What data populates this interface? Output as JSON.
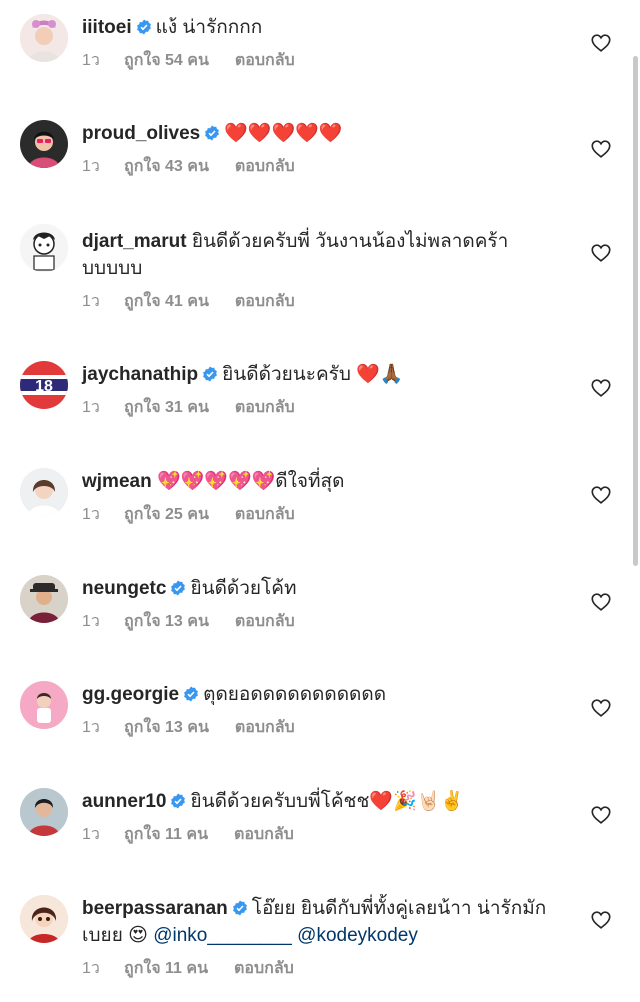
{
  "comments": [
    {
      "username": "iiitoei",
      "verified": true,
      "text": "แง้ น่ารักกกก",
      "time": "1ว",
      "likes": "ถูกใจ 54 คน",
      "reply": "ตอบกลับ"
    },
    {
      "username": "proud_olives",
      "verified": true,
      "text": "❤️❤️❤️❤️❤️",
      "time": "1ว",
      "likes": "ถูกใจ 43 คน",
      "reply": "ตอบกลับ"
    },
    {
      "username": "djart_marut",
      "verified": false,
      "text": "ยินดีด้วยครับพี่ วันงานน้องไม่พลาดคร้าบบบบบ",
      "time": "1ว",
      "likes": "ถูกใจ 41 คน",
      "reply": "ตอบกลับ"
    },
    {
      "username": "jaychanathip",
      "verified": true,
      "text": "ยินดีด้วยนะครับ ❤️🙏🏾",
      "time": "1ว",
      "likes": "ถูกใจ 31 คน",
      "reply": "ตอบกลับ"
    },
    {
      "username": "wjmean",
      "verified": false,
      "text": "💖💖💖💖💖ดีใจที่สุด",
      "time": "1ว",
      "likes": "ถูกใจ 25 คน",
      "reply": "ตอบกลับ"
    },
    {
      "username": "neungetc",
      "verified": true,
      "text": "ยินดีด้วยโค้ท",
      "time": "1ว",
      "likes": "ถูกใจ 13 คน",
      "reply": "ตอบกลับ"
    },
    {
      "username": "gg.georgie",
      "verified": true,
      "text": "ตุดยอดดดดดดดดดดด",
      "time": "1ว",
      "likes": "ถูกใจ 13 คน",
      "reply": "ตอบกลับ"
    },
    {
      "username": "aunner10",
      "verified": true,
      "text": "ยินดีด้วยครับบพี่โค้ชช❤️🎉🤘🏻✌️",
      "time": "1ว",
      "likes": "ถูกใจ 11 คน",
      "reply": "ตอบกลับ"
    },
    {
      "username": "beerpassaranan",
      "verified": true,
      "text": "โอ๊ยย ยินดีกับพี่ทั้งคู่เลยน้าา น่ารักมักเบยย 😍",
      "mentions": [
        "@inko________",
        "@kodeykodey"
      ],
      "time": "1ว",
      "likes": "ถูกใจ 11 คน",
      "reply": "ตอบกลับ"
    }
  ],
  "icons": {
    "verified": "verified-badge-icon",
    "like": "heart-outline-icon"
  },
  "colors": {
    "text": "#262626",
    "meta": "#8e8e8e",
    "verified": "#3897f0",
    "mention": "#00376b"
  }
}
